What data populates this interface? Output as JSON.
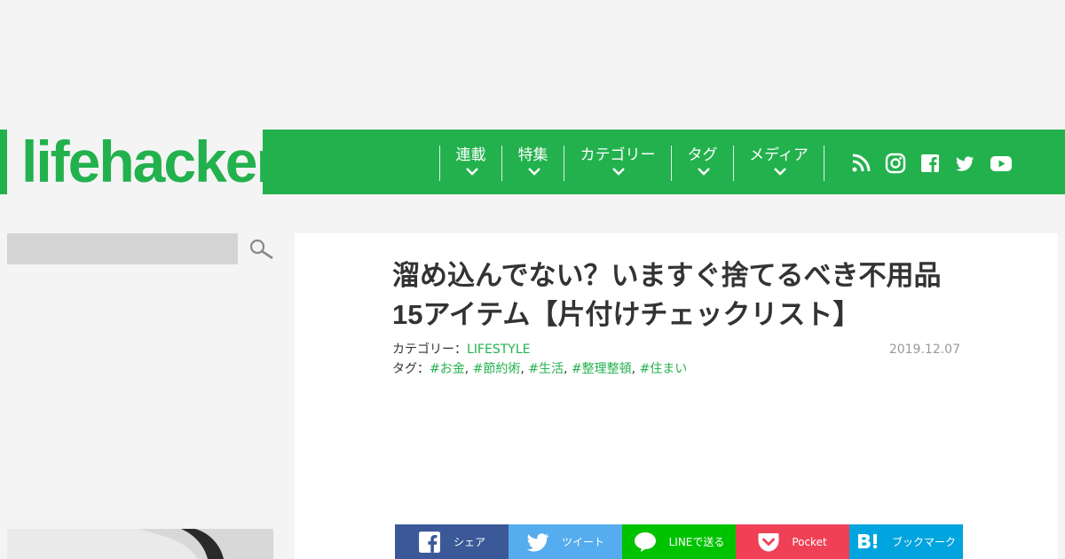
{
  "header": {
    "logo_text": "lifehacker",
    "brand_color": "#23b14d",
    "nav": [
      {
        "label": "連載"
      },
      {
        "label": "特集"
      },
      {
        "label": "カテゴリー"
      },
      {
        "label": "タグ"
      },
      {
        "label": "メディア"
      }
    ],
    "social_icons": [
      "rss-icon",
      "instagram-icon",
      "facebook-icon",
      "twitter-icon",
      "youtube-icon"
    ]
  },
  "sidebar": {
    "search_placeholder": "",
    "search_icon": "search-icon"
  },
  "article": {
    "title": "溜め込んでない？いますぐ捨てるべき不用品15アイテム【片付けチェックリスト】",
    "category_label": "カテゴリー：",
    "category": "LIFESTYLE",
    "tags_label": "タグ：",
    "tags": [
      "#お金",
      "#節約術",
      "#生活",
      "#整理整頓",
      "#住まい"
    ],
    "date": "2019.12.07"
  },
  "share": [
    {
      "label": "シェア",
      "icon": "facebook-icon",
      "color": "#3b5998"
    },
    {
      "label": "ツイート",
      "icon": "twitter-icon",
      "color": "#55acee"
    },
    {
      "label": "LINEで送る",
      "icon": "line-icon",
      "color": "#00c300"
    },
    {
      "label": "Pocket",
      "icon": "pocket-icon",
      "color": "#ef4056"
    },
    {
      "label": "ブックマーク",
      "icon": "hatena-bookmark-icon",
      "color": "#00a4de"
    }
  ]
}
